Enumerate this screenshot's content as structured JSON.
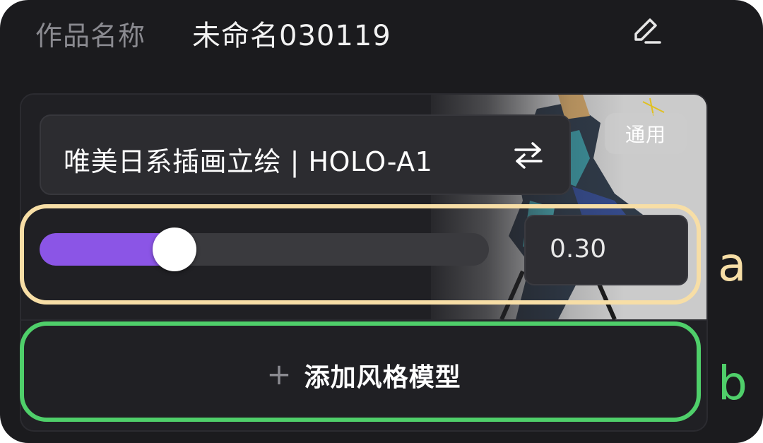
{
  "header": {
    "label": "作品名称",
    "title": "未命名030119",
    "edit_icon": "edit-pencil-icon"
  },
  "style_model": {
    "name": "唯美日系插画立绘 | HOLO-A1",
    "badge": "通用",
    "swap_icon": "swap-arrows-icon",
    "weight_value": "0.30",
    "weight_fraction": 0.3
  },
  "add_model": {
    "plus": "+",
    "label": "添加风格模型"
  },
  "annotations": {
    "a": "a",
    "b": "b",
    "a_color": "#f7dea6",
    "b_color": "#4fcf6a"
  },
  "colors": {
    "accent": "#8b55e6",
    "background": "#1b1b1e"
  }
}
